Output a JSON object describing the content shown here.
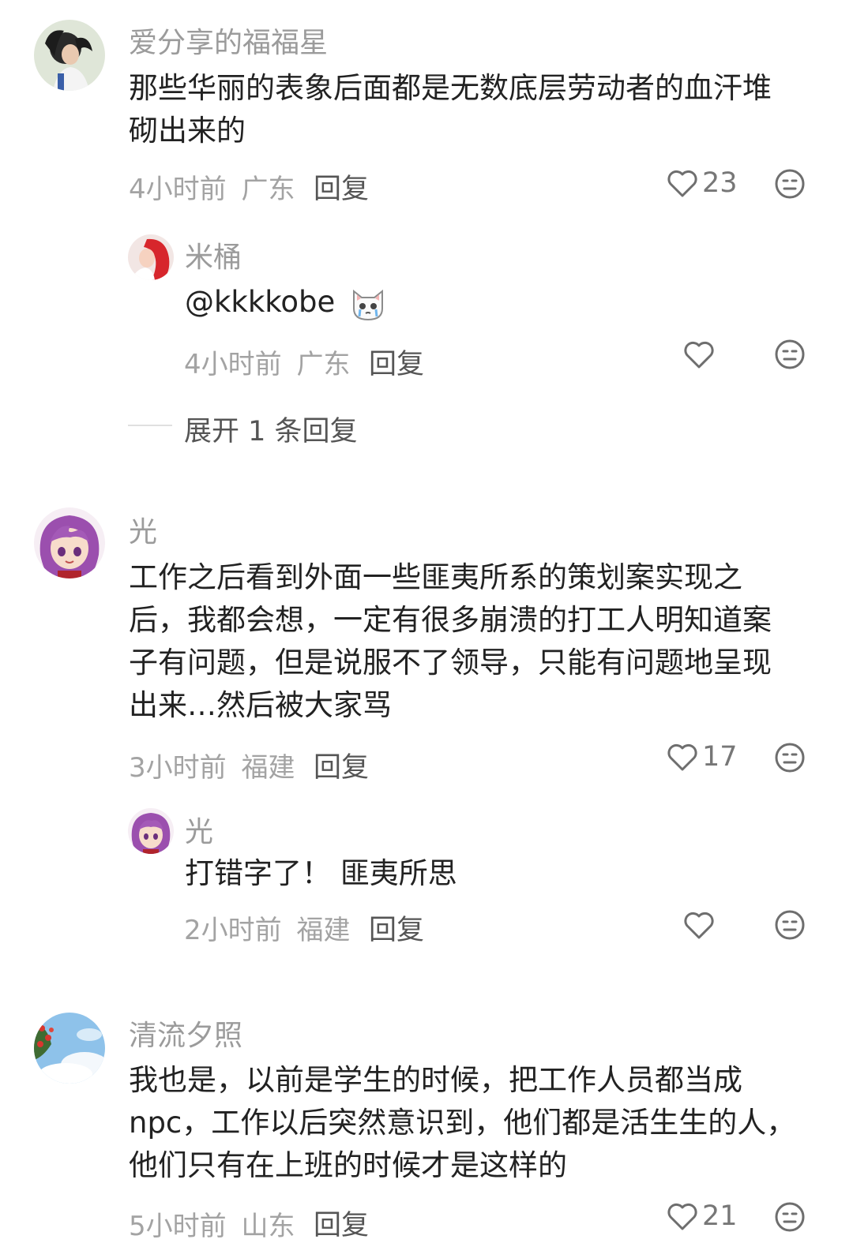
{
  "comments": [
    {
      "user": "爱分享的福福星",
      "text": "那些华丽的表象后面都是无数底层劳动者的血汗堆砌出来的",
      "time": "4小时前",
      "location": "广东",
      "reply_label": "回复",
      "likes": "23",
      "replies": [
        {
          "user": "米桶",
          "text": "@kkkkobe",
          "emoji": "crying-cat-emoji",
          "time": "4小时前",
          "location": "广东",
          "reply_label": "回复",
          "likes": ""
        }
      ],
      "expand_label": "展开 1 条回复"
    },
    {
      "user": "光",
      "text": "工作之后看到外面一些匪夷所系的策划案实现之后，我都会想，一定有很多崩溃的打工人明知道案子有问题，但是说服不了领导，只能有问题地呈现出来…然后被大家骂",
      "time": "3小时前",
      "location": "福建",
      "reply_label": "回复",
      "likes": "17",
      "replies": [
        {
          "user": "光",
          "text": "打错字了！ 匪夷所思",
          "time": "2小时前",
          "location": "福建",
          "reply_label": "回复",
          "likes": ""
        }
      ]
    },
    {
      "user": "清流夕照",
      "text": "我也是，以前是学生的时候，把工作人员都当成npc，工作以后突然意识到，他们都是活生生的人，他们只有在上班的时候才是这样的",
      "time": "5小时前",
      "location": "山东",
      "reply_label": "回复",
      "likes": "21"
    }
  ],
  "colors": {
    "username": "#9b9b9b",
    "meta": "#a3a3a3",
    "text": "#222222",
    "action": "#555555"
  }
}
